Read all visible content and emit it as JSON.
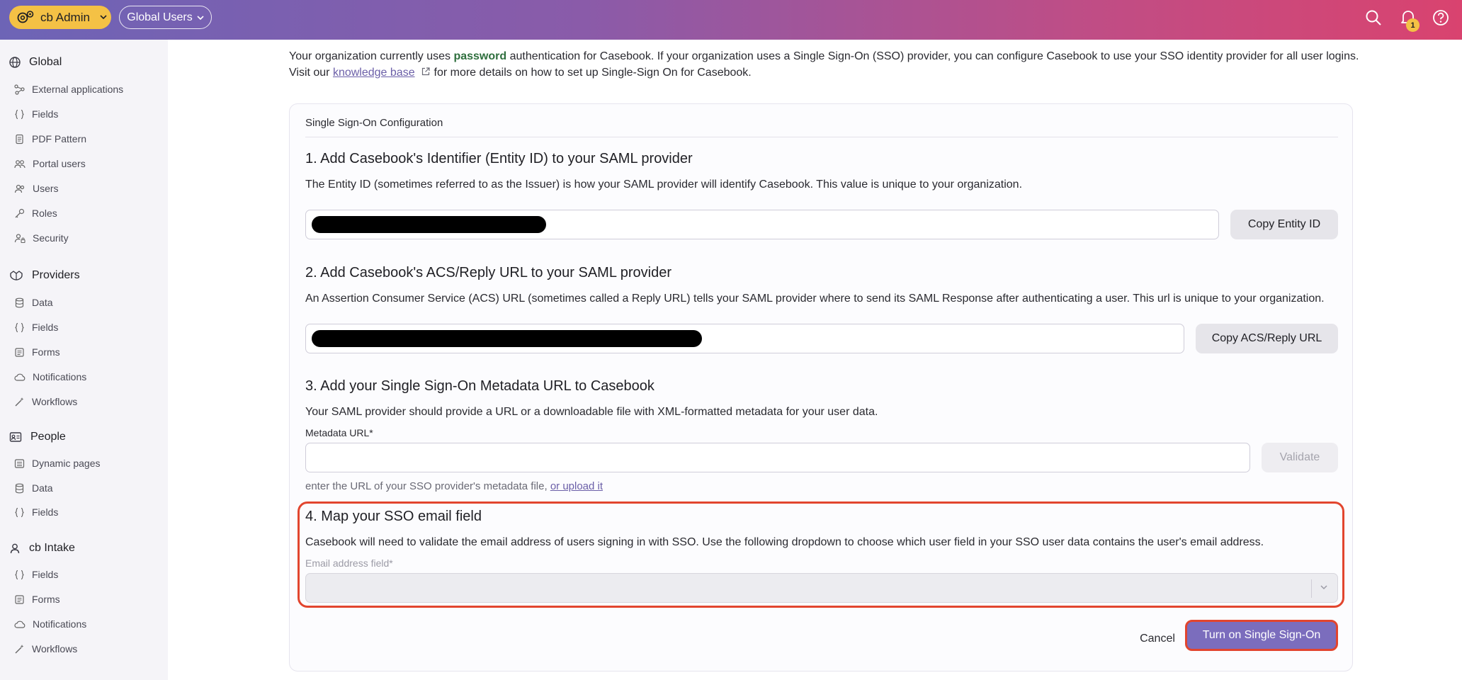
{
  "topbar": {
    "app_label": "cb Admin",
    "scope_label": "Global Users",
    "notification_count": "1",
    "icons": [
      "settings-gear-icon",
      "search-icon",
      "bell-icon",
      "help-icon"
    ]
  },
  "sidebar": {
    "sections": [
      {
        "title": "Global",
        "items": [
          "External applications",
          "Fields",
          "PDF Pattern",
          "Portal users",
          "Users",
          "Roles",
          "Security"
        ]
      },
      {
        "title": "Providers",
        "items": [
          "Data",
          "Fields",
          "Forms",
          "Notifications",
          "Workflows"
        ]
      },
      {
        "title": "People",
        "items": [
          "Dynamic pages",
          "Data",
          "Fields"
        ]
      },
      {
        "title": "cb Intake",
        "items": [
          "Fields",
          "Forms",
          "Notifications",
          "Workflows"
        ]
      }
    ]
  },
  "intro": {
    "part1": "Your organization currently uses ",
    "auth_method": "password",
    "part2": " authentication for Casebook. If your organization uses a Single Sign-On (SSO) provider, you can configure Casebook to use your SSO identity provider for all user logins.",
    "part3": "Visit our ",
    "kb_link": "knowledge base",
    "part4": " for more details on how to set up Single-Sign On for Casebook."
  },
  "card": {
    "title": "Single Sign-On Configuration",
    "step1": {
      "title": "1. Add Casebook's Identifier (Entity ID) to your SAML provider",
      "desc": "The Entity ID (sometimes referred to as the Issuer) is how your SAML provider will identify Casebook. This value is unique to your organization.",
      "button": "Copy Entity ID"
    },
    "step2": {
      "title": "2. Add Casebook's ACS/Reply URL to your SAML provider",
      "desc": "An Assertion Consumer Service (ACS) URL (sometimes called a Reply URL) tells your SAML provider where to send its SAML Response after authenticating a user. This url is unique to your organization.",
      "button": "Copy ACS/Reply URL"
    },
    "step3": {
      "title": "3. Add your Single Sign-On Metadata URL to Casebook",
      "desc": "Your SAML provider should provide a URL or a downloadable file with XML-formatted metadata for your user data.",
      "field_label": "Metadata URL",
      "required_mark": "*",
      "input_value": "",
      "button": "Validate",
      "helper_text": "enter the URL of your SSO provider's metadata file, ",
      "helper_link": "or upload it"
    },
    "step4": {
      "title": "4. Map your SSO email field",
      "desc": "Casebook will need to validate the email address of users signing in with SSO. Use the following dropdown to choose which user field in your SSO user data contains the user's email address.",
      "field_label": "Email address field",
      "required_mark": "*",
      "selected_value": ""
    },
    "cancel_label": "Cancel",
    "submit_label": "Turn on Single Sign-On"
  }
}
